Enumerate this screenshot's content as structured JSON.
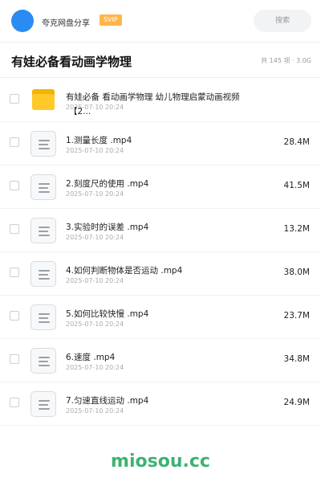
{
  "header": {
    "brand": "夸克网盘分享",
    "badge": "SVIP",
    "search_label": "搜索"
  },
  "folder": {
    "title": "有娃必备看动画学物理",
    "meta": "共 145 项 · 3.0G"
  },
  "items": [
    {
      "type": "folder",
      "name_line1": "有娃必备 看动画学物理 幼儿物理启蒙动画视频",
      "name_line2": "【2...",
      "date": "2025-07-10 20:24",
      "size": ""
    },
    {
      "type": "file",
      "name": "1.测量长度 .mp4",
      "date": "2025-07-10 20:24",
      "size": "28.4M"
    },
    {
      "type": "file",
      "name": "2.刻度尺的使用 .mp4",
      "date": "2025-07-10 20:24",
      "size": "41.5M"
    },
    {
      "type": "file",
      "name": "3.实验时的误差 .mp4",
      "date": "2025-07-10 20:24",
      "size": "13.2M"
    },
    {
      "type": "file",
      "name": "4.如何判断物体是否运动 .mp4",
      "date": "2025-07-10 20:24",
      "size": "38.0M"
    },
    {
      "type": "file",
      "name": "5.如何比较快慢 .mp4",
      "date": "2025-07-10 20:24",
      "size": "23.7M"
    },
    {
      "type": "file",
      "name": "6.速度 .mp4",
      "date": "2025-07-10 20:24",
      "size": "34.8M"
    },
    {
      "type": "file",
      "name": "7.匀速直线运动 .mp4",
      "date": "2025-07-10 20:24",
      "size": "24.9M"
    }
  ],
  "watermark": "miosou.cc"
}
